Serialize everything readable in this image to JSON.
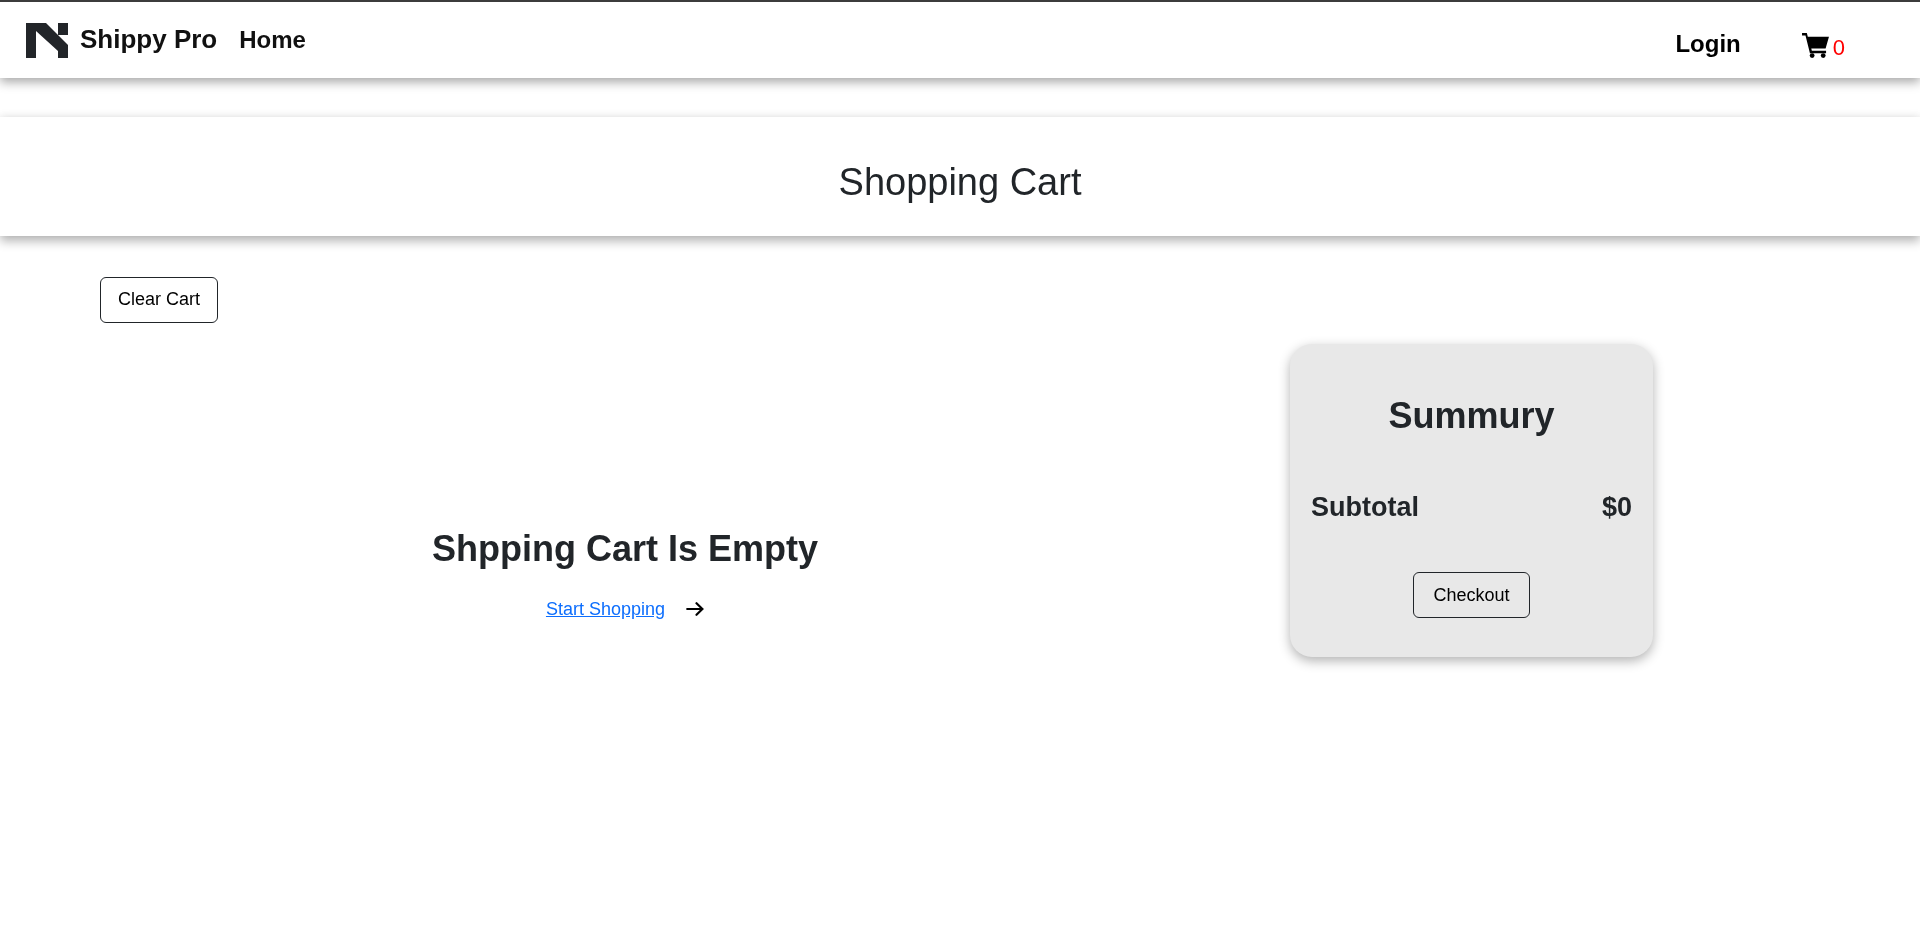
{
  "navbar": {
    "brand": "Shippy Pro",
    "links": [
      {
        "label": "Home"
      }
    ],
    "login": "Login",
    "cart": {
      "count": "0"
    }
  },
  "page_header": {
    "title": "Shopping Cart"
  },
  "clear_button": "Clear Cart",
  "empty_state": {
    "heading": "Shpping Cart Is Empty",
    "link": "Start Shopping"
  },
  "summary": {
    "title": "Summury",
    "rows": [
      {
        "label": "Subtotal",
        "value": "$0"
      }
    ],
    "button": "Checkout"
  }
}
